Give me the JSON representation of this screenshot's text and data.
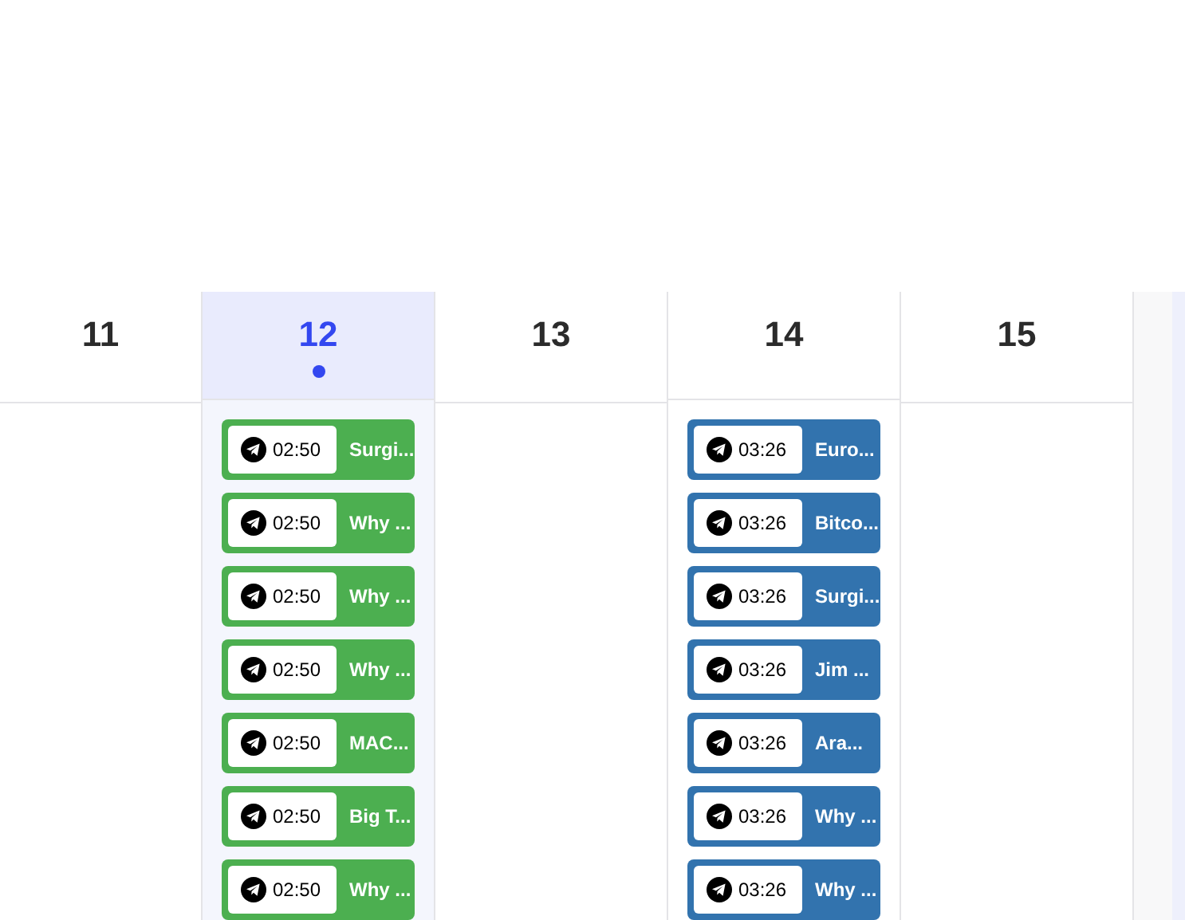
{
  "days": [
    {
      "label": "11",
      "selected": false
    },
    {
      "label": "12",
      "selected": true,
      "events": [
        {
          "time": "02:50",
          "title": "Surgi...",
          "color": "#4caf50"
        },
        {
          "time": "02:50",
          "title": "Why ...",
          "color": "#4caf50"
        },
        {
          "time": "02:50",
          "title": "Why ...",
          "color": "#4caf50"
        },
        {
          "time": "02:50",
          "title": "Why ...",
          "color": "#4caf50"
        },
        {
          "time": "02:50",
          "title": "MAC...",
          "color": "#4caf50"
        },
        {
          "time": "02:50",
          "title": "Big T...",
          "color": "#4caf50"
        },
        {
          "time": "02:50",
          "title": "Why ...",
          "color": "#4caf50"
        }
      ]
    },
    {
      "label": "13",
      "selected": false
    },
    {
      "label": "14",
      "selected": false,
      "events": [
        {
          "time": "03:26",
          "title": "Euro...",
          "color": "#3273ae"
        },
        {
          "time": "03:26",
          "title": "Bitco...",
          "color": "#3273ae"
        },
        {
          "time": "03:26",
          "title": "Surgi...",
          "color": "#3273ae"
        },
        {
          "time": "03:26",
          "title": "Jim ...",
          "color": "#3273ae"
        },
        {
          "time": "03:26",
          "title": "Ara...",
          "color": "#3273ae"
        },
        {
          "time": "03:26",
          "title": "Why ...",
          "color": "#3273ae"
        },
        {
          "time": "03:26",
          "title": "Why ...",
          "color": "#3273ae"
        }
      ]
    },
    {
      "label": "15",
      "selected": false
    }
  ]
}
